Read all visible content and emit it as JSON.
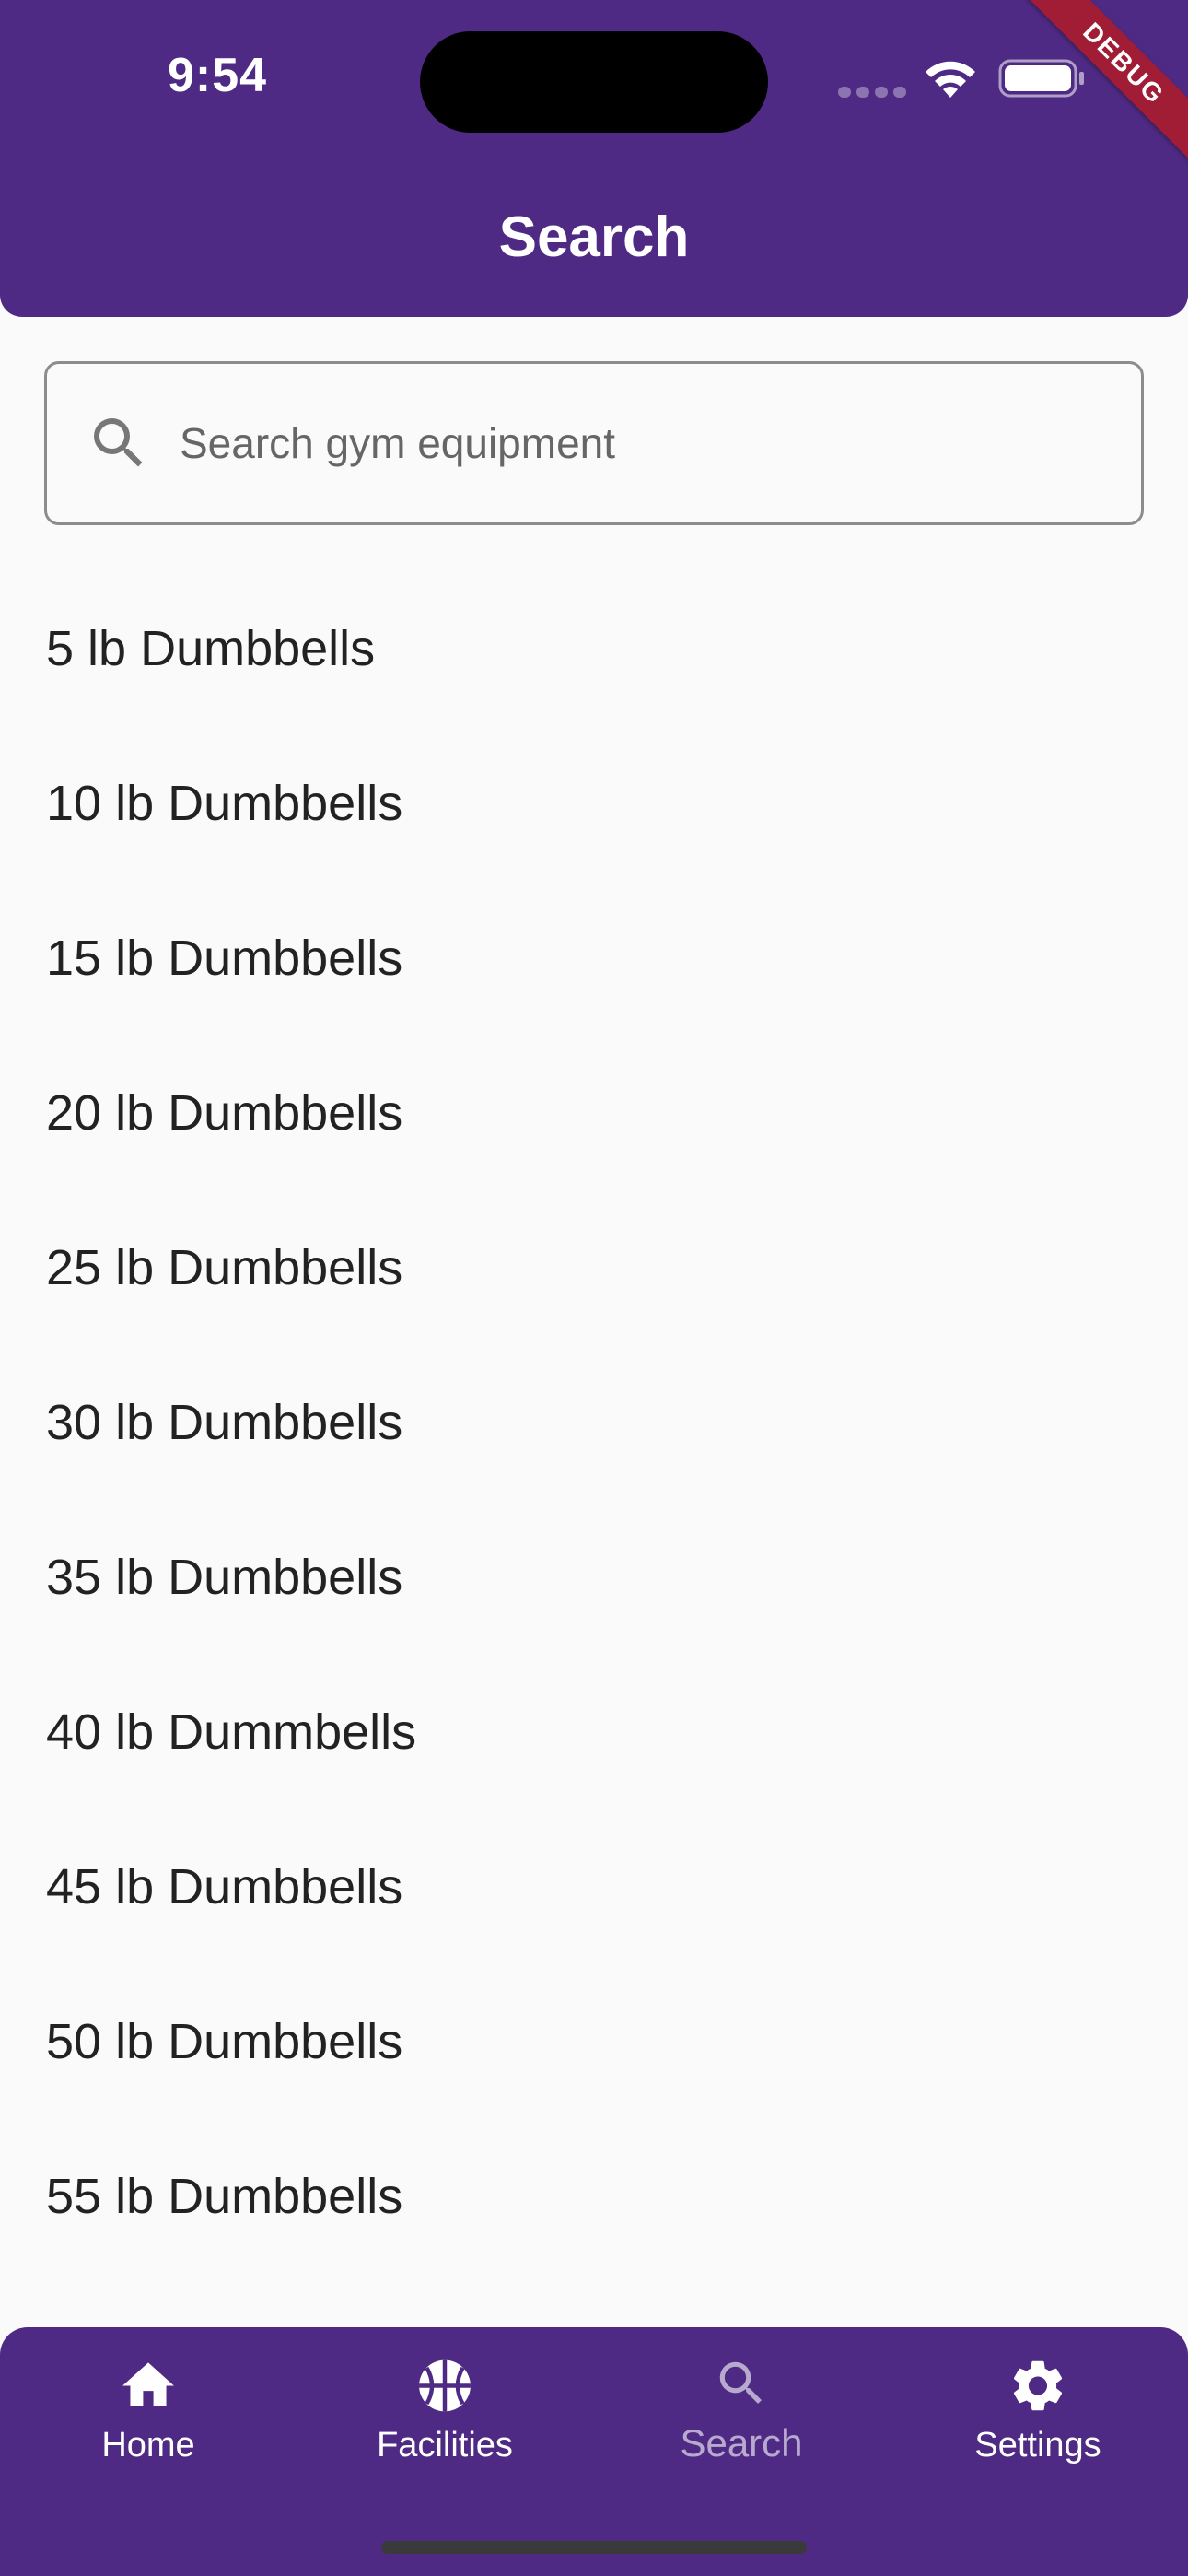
{
  "status_bar": {
    "time": "9:54"
  },
  "debug_banner": "DEBUG",
  "header": {
    "title": "Search"
  },
  "search": {
    "placeholder": "Search gym equipment",
    "value": ""
  },
  "equipment": [
    "5 lb Dumbbells",
    "10 lb Dumbbells",
    "15 lb Dumbbells",
    "20 lb Dumbbells",
    "25 lb Dumbbells",
    "30 lb Dumbbells",
    "35 lb Dumbbells",
    "40 lb Dummbells",
    "45 lb Dumbbells",
    "50 lb Dumbbells",
    "55 lb Dumbbells"
  ],
  "nav": [
    {
      "label": "Home",
      "icon": "home-icon"
    },
    {
      "label": "Facilities",
      "icon": "basketball-icon"
    },
    {
      "label": "Search",
      "icon": "search-icon",
      "active": true
    },
    {
      "label": "Settings",
      "icon": "gear-icon"
    }
  ],
  "colors": {
    "brand": "#4e2a84",
    "debug": "#a11c35",
    "background": "#fafafa"
  }
}
